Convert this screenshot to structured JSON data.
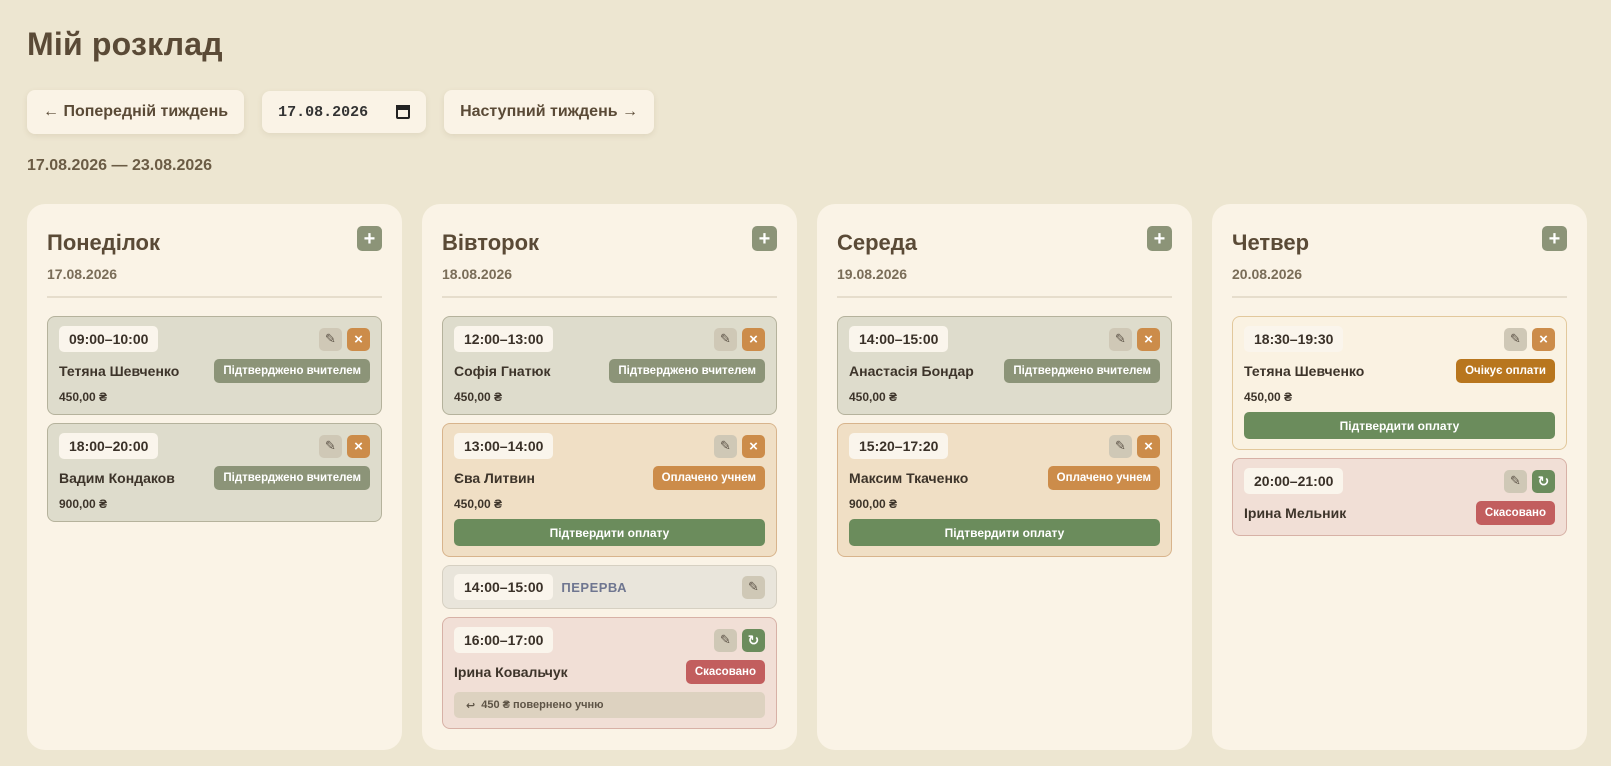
{
  "page_title": "Мій розклад",
  "nav": {
    "prev_label": "← Попередній тиждень",
    "date_value": "17.08.2026",
    "next_label": "Наступний тиждень →"
  },
  "week_range": "17.08.2026 — 23.08.2026",
  "days": [
    {
      "name": "Понеділок",
      "date": "17.08.2026",
      "lessons": [
        {
          "time": "09:00–10:00",
          "student": "Тетяна Шевченко",
          "status": "Підтверджено вчителем",
          "price": "450,00 ₴"
        },
        {
          "time": "18:00–20:00",
          "student": "Вадим Кондаков",
          "status": "Підтверджено вчителем",
          "price": "900,00 ₴"
        }
      ]
    },
    {
      "name": "Вівторок",
      "date": "18.08.2026",
      "lessons": [
        {
          "time": "12:00–13:00",
          "student": "Софія Гнатюк",
          "status": "Підтверджено вчителем",
          "price": "450,00 ₴"
        },
        {
          "time": "13:00–14:00",
          "student": "Єва Литвин",
          "status": "Оплачено учнем",
          "price": "450,00 ₴",
          "action": "Підтвердити оплату"
        },
        {
          "time": "14:00–15:00",
          "break_label": "ПЕРЕРВА"
        },
        {
          "time": "16:00–17:00",
          "student": "Ірина Ковальчук",
          "status": "Скасовано",
          "refund": "450 ₴ повернено учню"
        }
      ]
    },
    {
      "name": "Середа",
      "date": "19.08.2026",
      "lessons": [
        {
          "time": "14:00–15:00",
          "student": "Анастасія Бондар",
          "status": "Підтверджено вчителем",
          "price": "450,00 ₴"
        },
        {
          "time": "15:20–17:20",
          "student": "Максим Ткаченко",
          "status": "Оплачено учнем",
          "price": "900,00 ₴",
          "action": "Підтвердити оплату"
        }
      ]
    },
    {
      "name": "Четвер",
      "date": "20.08.2026",
      "lessons": [
        {
          "time": "18:30–19:30",
          "student": "Тетяна Шевченко",
          "status": "Очікує оплати",
          "price": "450,00 ₴",
          "action": "Підтвердити оплату"
        },
        {
          "time": "20:00–21:00",
          "student": "Ірина Мельник",
          "status": "Скасовано"
        }
      ]
    }
  ],
  "icons": {
    "add": "plus-icon",
    "edit": "pencil-icon",
    "cancel": "close-icon",
    "restore": "restore-icon",
    "refund": "return-arrow-icon",
    "calendar": "calendar-icon"
  },
  "colors": {
    "background": "#ede6d1",
    "card": "#faf3e6",
    "confirmed": "#8c9478",
    "paid": "#cc8c4a",
    "pending": "#b8761e",
    "cancelled": "#c25e5e",
    "action_green": "#6b8c5c"
  }
}
